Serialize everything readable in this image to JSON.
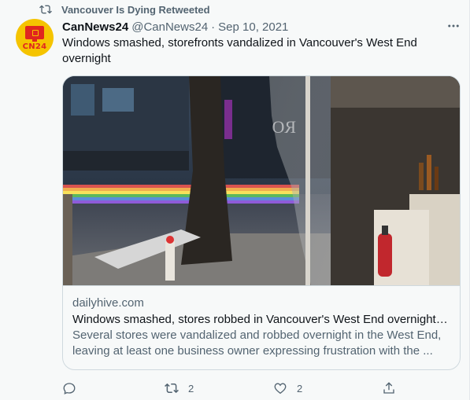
{
  "retweet": {
    "label": "Vancouver Is Dying Retweeted",
    "icon": "retweet-icon"
  },
  "author": {
    "avatar_text": "CN24",
    "avatar_color": "#f5c400",
    "name": "CanNews24",
    "handle": "@CanNews24",
    "separator": "·",
    "date": "Sep 10, 2021"
  },
  "tweet": {
    "text": "Windows smashed, storefronts vandalized in Vancouver's West End overnight"
  },
  "card": {
    "image_alt": "Photo of a smashed storefront window at night on a Vancouver street",
    "domain": "dailyhive.com",
    "title": "Windows smashed, stores robbed in Vancouver's West End overnight |...",
    "description": "Several stores were vandalized and robbed overnight in the West End, leaving at least one business owner expressing frustration with the ..."
  },
  "actions": {
    "reply": {
      "icon": "reply-icon",
      "count": ""
    },
    "retweet": {
      "icon": "retweet-icon",
      "count": "2"
    },
    "like": {
      "icon": "heart-icon",
      "count": "2"
    },
    "share": {
      "icon": "share-icon",
      "count": ""
    }
  },
  "colors": {
    "background": "#f7f9f9",
    "text_primary": "#0f1419",
    "text_secondary": "#536471",
    "border": "#cfd9de"
  }
}
